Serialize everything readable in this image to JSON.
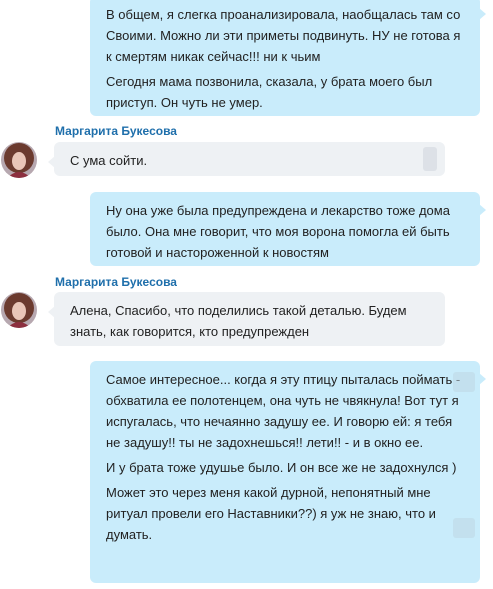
{
  "conversation": {
    "messages": [
      {
        "direction": "outgoing",
        "paragraphs": [
          "В общем, я слегка проанализировала, наобщалась там со Своими. Можно ли эти приметы подвинуть.  НУ не готова я к смертям никак сейчас!!! ни к чьим",
          "Сегодня мама позвонила, сказала, у брата моего был приступ. Он чуть не умер."
        ]
      },
      {
        "direction": "incoming",
        "sender": "Маргарита Букесова",
        "avatar_icon": "user-avatar",
        "paragraphs": [
          "С ума сойти."
        ]
      },
      {
        "direction": "outgoing",
        "paragraphs": [
          "Ну она уже была предупреждена и лекарство тоже дома было. Она мне говорит, что моя ворона помогла ей быть готовой и настороженной к новостям"
        ]
      },
      {
        "direction": "incoming",
        "sender": "Маргарита Букесова",
        "avatar_icon": "user-avatar",
        "paragraphs": [
          "Алена, Спасибо, что поделились такой деталью. Будем знать, как говорится, кто предупрежден"
        ]
      },
      {
        "direction": "outgoing",
        "paragraphs": [
          "Самое интересное... когда я эту птицу пыталась поймать - обхватила ее полотенцем, она чуть не чвякнула! Вот тут я испугалась, что нечаянно задушу ее. И говорю ей: я тебя не задушу!! ты не задохнешься!! лети!! - и в окно ее.",
          "И у брата тоже удушье было. И он все же не задохнулся )",
          "Может это через меня какой дурной, непонятный мне ритуал провели его Наставники??) я уж не знаю, что и думать."
        ]
      }
    ]
  },
  "colors": {
    "outgoing_bubble": "#c9ecfb",
    "incoming_bubble": "#eef1f4",
    "sender_name": "#1f6fab",
    "text": "#222222"
  }
}
